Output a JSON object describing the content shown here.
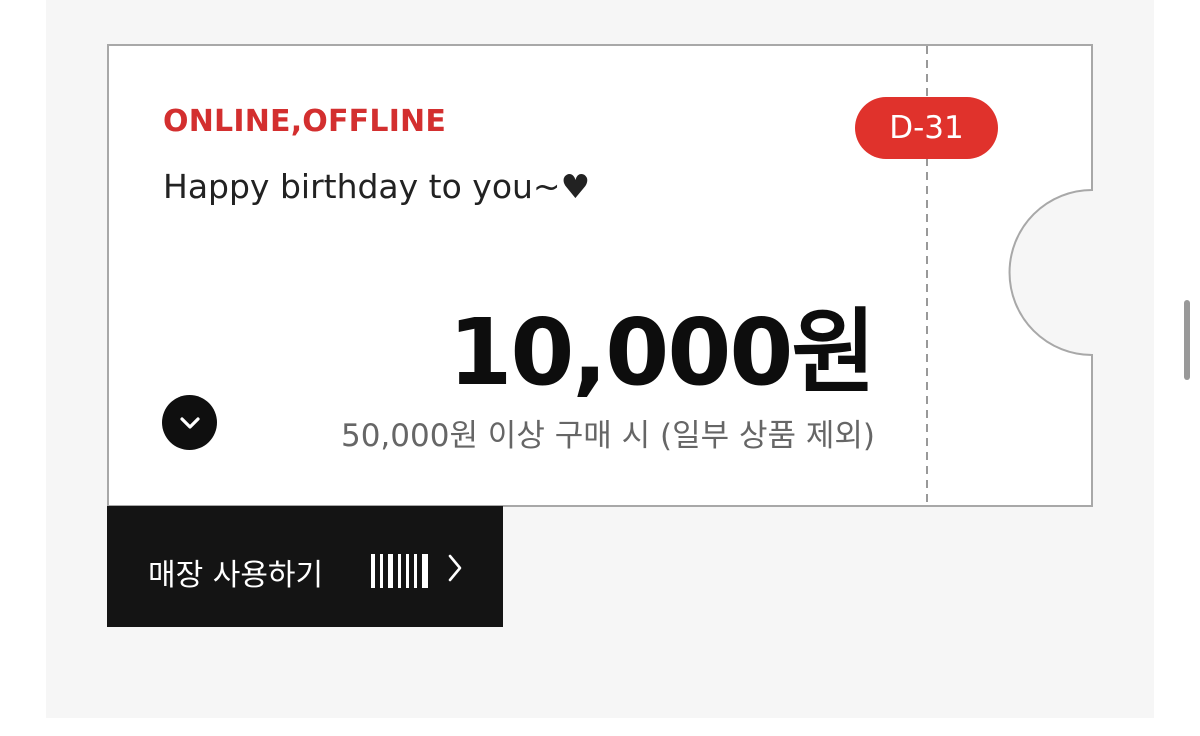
{
  "coupon": {
    "channel": "ONLINE,OFFLINE",
    "message": "Happy birthday to you~♥",
    "d_day": "D-31",
    "amount": "10,000원",
    "condition": "50,000원 이상 구매 시 (일부 상품 제외)"
  },
  "store_button": {
    "label": "매장 사용하기"
  },
  "colors": {
    "accent": "#e0322c",
    "channel_text": "#d32f2f",
    "button_bg": "#141414"
  },
  "icons": {
    "expand": "chevron-down-icon",
    "barcode": "barcode-icon",
    "arrow": "chevron-right-icon"
  }
}
